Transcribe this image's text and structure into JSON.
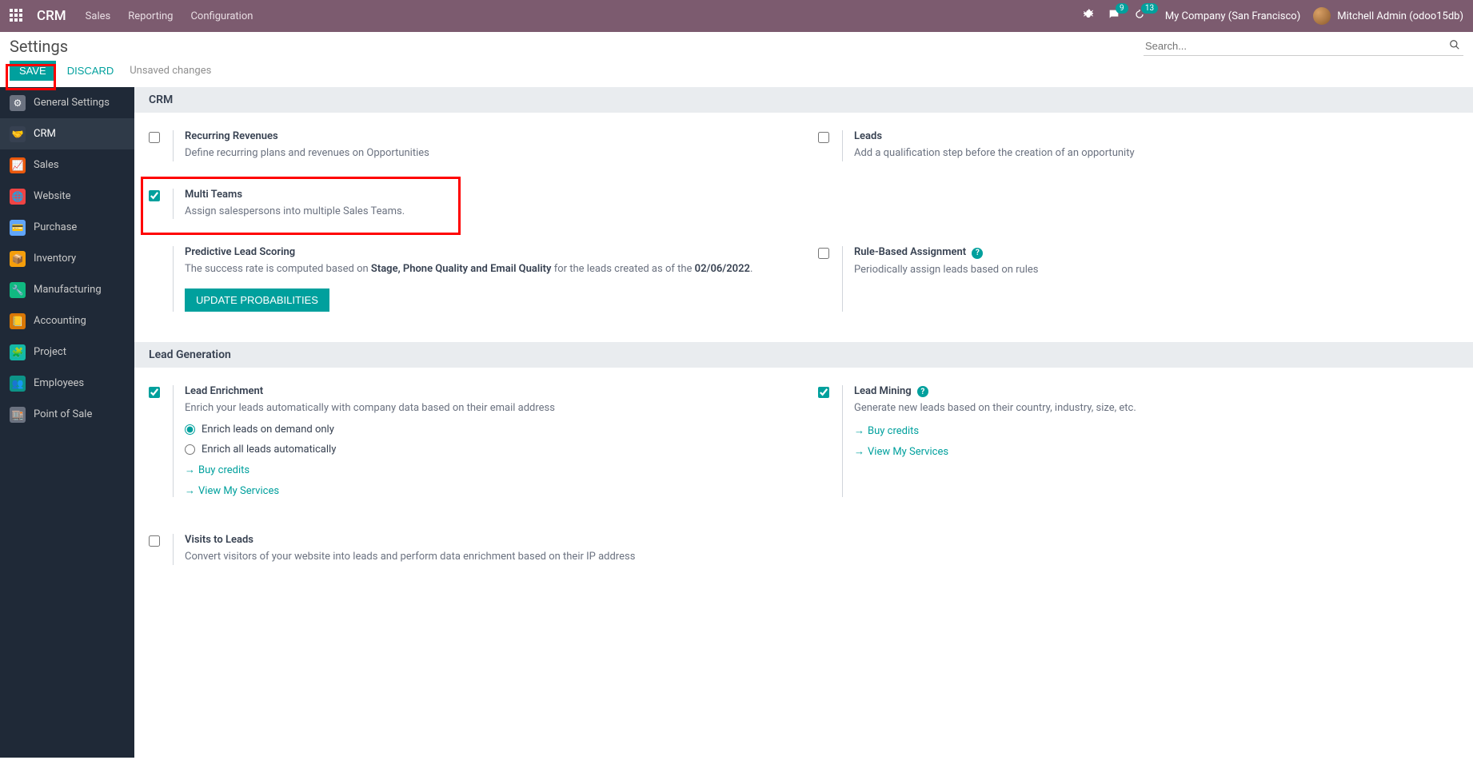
{
  "navbar": {
    "brand": "CRM",
    "links": [
      "Sales",
      "Reporting",
      "Configuration"
    ],
    "msg_badge": "9",
    "activity_badge": "13",
    "company": "My Company (San Francisco)",
    "user": "Mitchell Admin (odoo15db)"
  },
  "ctrl": {
    "title": "Settings",
    "search_placeholder": "Search...",
    "save": "SAVE",
    "discard": "DISCARD",
    "unsaved": "Unsaved changes"
  },
  "sidebar": {
    "items": [
      "General Settings",
      "CRM",
      "Sales",
      "Website",
      "Purchase",
      "Inventory",
      "Manufacturing",
      "Accounting",
      "Project",
      "Employees",
      "Point of Sale"
    ]
  },
  "sections": {
    "crm": {
      "header": "CRM",
      "recurring": {
        "title": "Recurring Revenues",
        "desc": "Define recurring plans and revenues on Opportunities"
      },
      "leads": {
        "title": "Leads",
        "desc": "Add a qualification step before the creation of an opportunity"
      },
      "multiteams": {
        "title": "Multi Teams",
        "desc": "Assign salespersons into multiple Sales Teams."
      },
      "predictive": {
        "title": "Predictive Lead Scoring",
        "desc_pre": "The success rate is computed based on ",
        "desc_bold1": "Stage, Phone Quality and Email Quality",
        "desc_mid": " for the leads created as of the ",
        "desc_bold2": "02/06/2022",
        "desc_post": ".",
        "button": "UPDATE PROBABILITIES"
      },
      "rulebased": {
        "title": "Rule-Based Assignment",
        "desc": "Periodically assign leads based on rules"
      }
    },
    "leadgen": {
      "header": "Lead Generation",
      "enrichment": {
        "title": "Lead Enrichment",
        "desc": "Enrich your leads automatically with company data based on their email address",
        "radio1": "Enrich leads on demand only",
        "radio2": "Enrich all leads automatically",
        "link1": "Buy credits",
        "link2": "View My Services"
      },
      "mining": {
        "title": "Lead Mining",
        "desc": "Generate new leads based on their country, industry, size, etc.",
        "link1": "Buy credits",
        "link2": "View My Services"
      },
      "visits": {
        "title": "Visits to Leads",
        "desc": "Convert visitors of your website into leads and perform data enrichment based on their IP address"
      }
    }
  }
}
